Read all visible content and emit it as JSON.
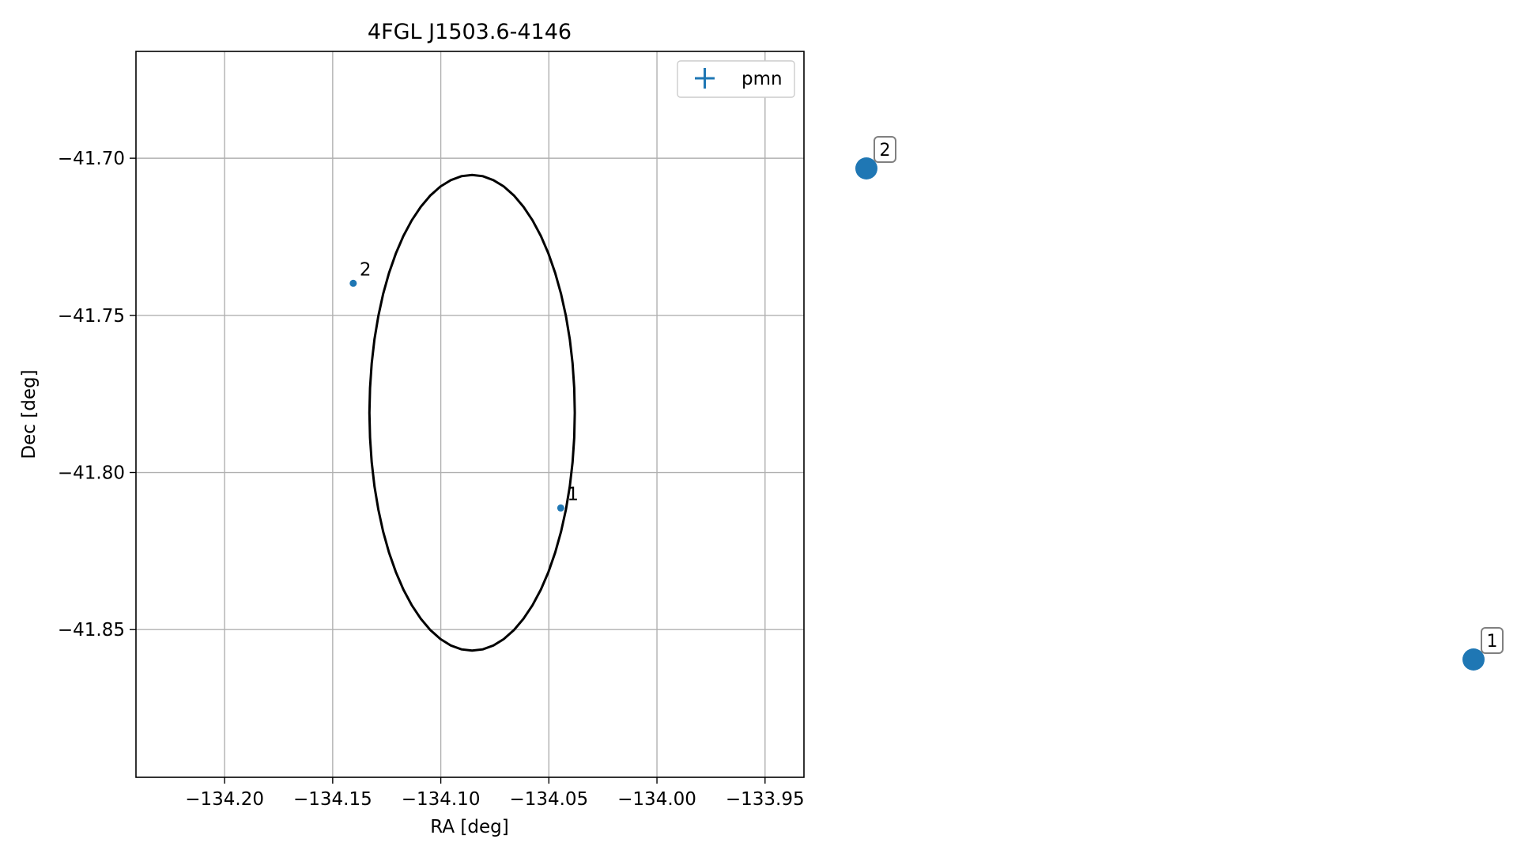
{
  "colors": {
    "series": "#1f77b4",
    "ellipse": "#000000",
    "grid": "#b0b0b0",
    "badge_border": "#808080"
  },
  "chart_data": {
    "type": "scatter",
    "title": "4FGL J1503.6-4146",
    "xlabel": "RA [deg]",
    "ylabel": "Dec [deg]",
    "xlim": [
      -134.241,
      -133.932
    ],
    "ylim": [
      -41.897,
      -41.666
    ],
    "x_inverted": false,
    "grid": true,
    "legend": {
      "placement": "top-right",
      "entries": [
        {
          "label": "pmn",
          "marker": "errorbar-cross"
        }
      ]
    },
    "xticks": [
      {
        "value": -134.2,
        "label": "−134.20"
      },
      {
        "value": -134.15,
        "label": "−134.15"
      },
      {
        "value": -134.1,
        "label": "−134.10"
      },
      {
        "value": -134.05,
        "label": "−134.05"
      },
      {
        "value": -134.0,
        "label": "−134.00"
      },
      {
        "value": -133.95,
        "label": "−133.95"
      }
    ],
    "yticks": [
      {
        "value": -41.7,
        "label": "−41.70"
      },
      {
        "value": -41.75,
        "label": "−41.75"
      },
      {
        "value": -41.8,
        "label": "−41.80"
      },
      {
        "value": -41.85,
        "label": "−41.85"
      }
    ],
    "ellipse": {
      "center": [
        -134.0855,
        -41.781
      ],
      "half_width": 0.0475,
      "half_height": 0.0757
    },
    "series": [
      {
        "name": "pmn",
        "points": [
          {
            "label": "1",
            "ra": -134.0445,
            "dec": -41.8113
          },
          {
            "label": "2",
            "ra": -134.1405,
            "dec": -41.7398
          }
        ]
      }
    ]
  },
  "side_markers": [
    {
      "label": "2"
    },
    {
      "label": "1"
    }
  ]
}
